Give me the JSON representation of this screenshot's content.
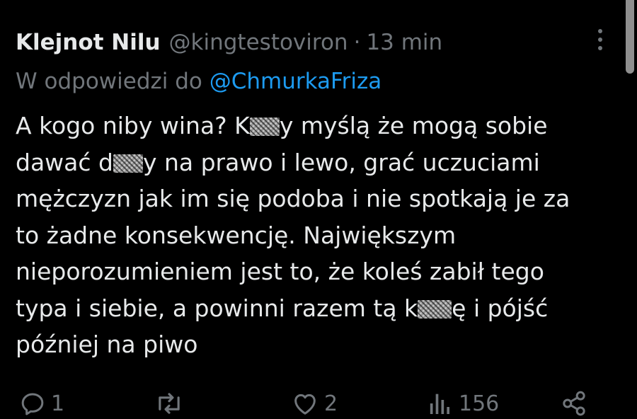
{
  "tweet": {
    "display_name": "Klejnot Nilu",
    "handle": "@kingtestoviron",
    "separator": "·",
    "time": "13 min",
    "reply_prefix": "W odpowiedzi do",
    "reply_mention": "@ChmurkaFriza",
    "body": {
      "l1a": "A kogo niby wina? K",
      "l1b": "y myślą że mogą sobie",
      "l2a": "dawać d",
      "l2b": "y na prawo i lewo, grać uczuciami",
      "l3": "mężczyzn jak im się podoba i nie spotkają je za",
      "l4": "to żadne konsekwencję. Największym",
      "l5": "nieporozumieniem jest to, że koleś zabił tego",
      "l6a": "typa i siebie, a powinni razem tą k",
      "l6b": "ę i pójść",
      "l7": "później na piwo"
    },
    "actions": {
      "reply_count": "1",
      "retweet_count": "",
      "like_count": "2",
      "views_count": "156"
    }
  },
  "icons": {
    "reply": "reply-icon",
    "retweet": "retweet-icon",
    "like": "heart-icon",
    "views": "views-icon",
    "share": "share-icon",
    "more": "more-icon"
  },
  "colors": {
    "background": "#000000",
    "text": "#e7e9ea",
    "secondary": "#71767b",
    "link": "#1d9bf0"
  }
}
